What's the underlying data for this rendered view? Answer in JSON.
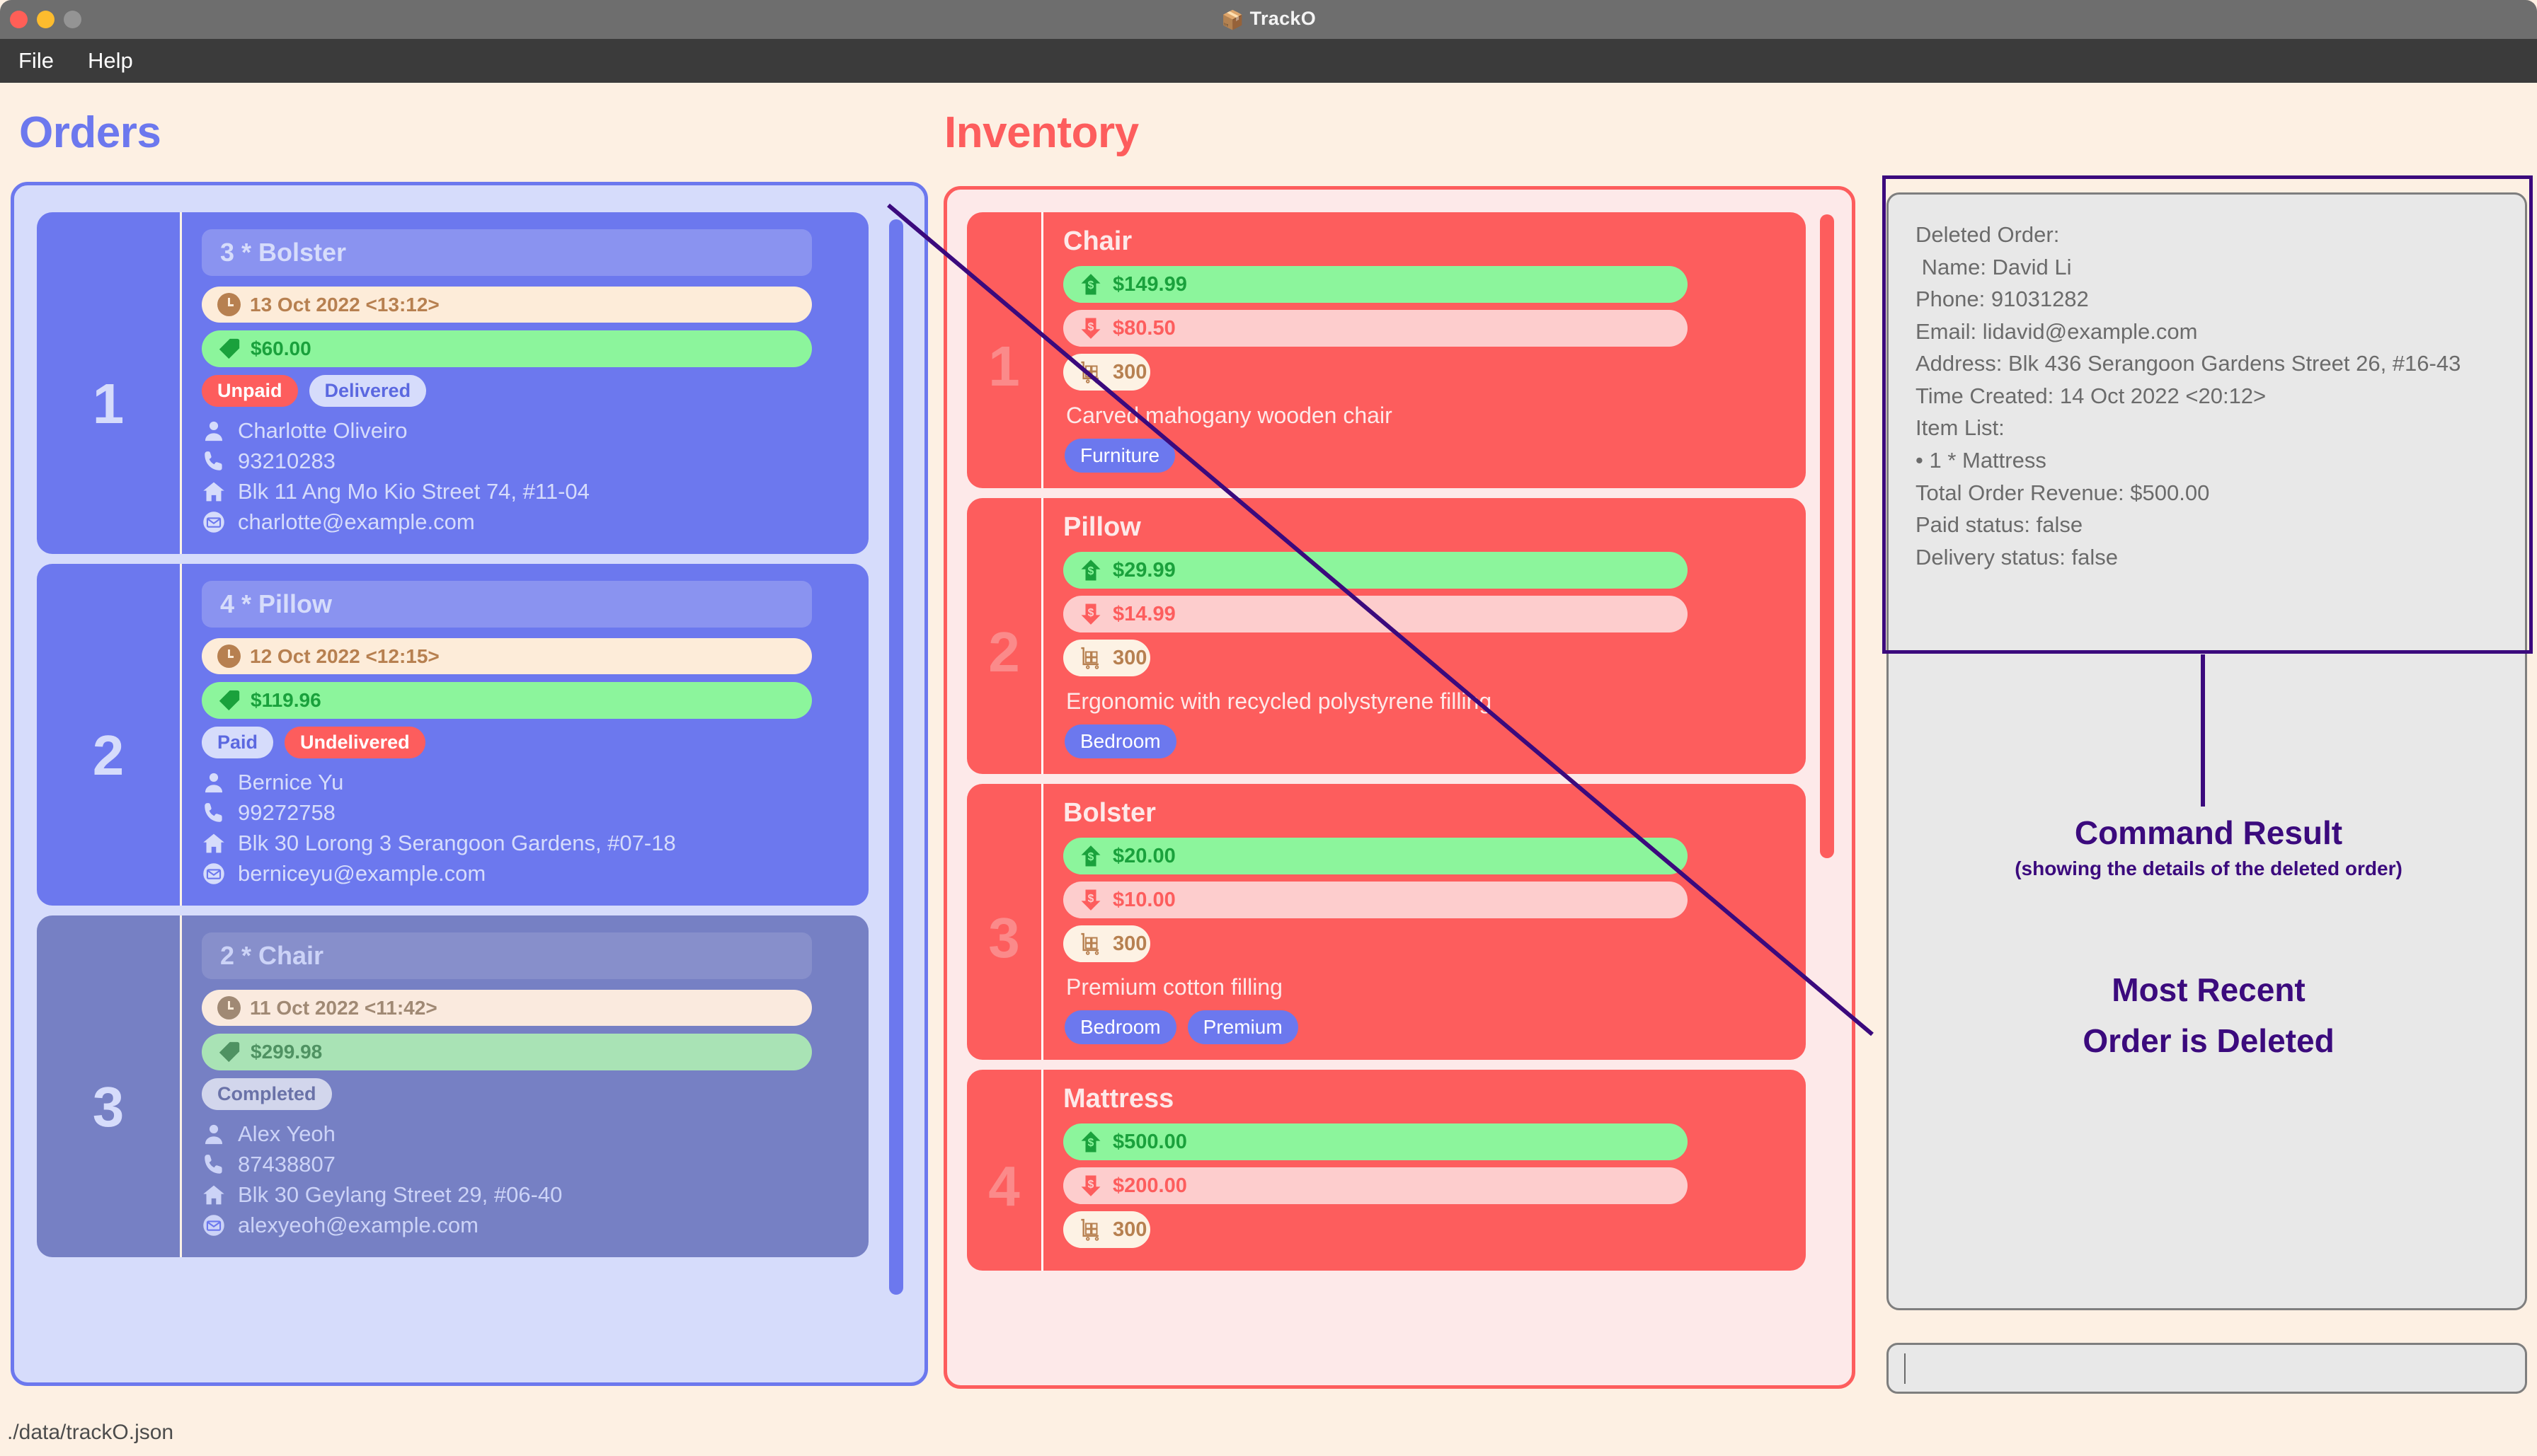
{
  "window": {
    "title": "TrackO",
    "title_icon": "package-box-icon",
    "traffic_lights": [
      "close",
      "minimize",
      "maximize"
    ]
  },
  "menubar": {
    "items": [
      "File",
      "Help"
    ]
  },
  "orders": {
    "heading": "Orders",
    "accent": "#6c78ee",
    "cards": [
      {
        "index": "1",
        "name": "3 * Bolster",
        "time": "13 Oct 2022 <13:12>",
        "price": "$60.00",
        "badges": [
          {
            "label": "Unpaid",
            "style": "unpaid"
          },
          {
            "label": "Delivered",
            "style": "delivered"
          }
        ],
        "customer": "Charlotte Oliveiro",
        "phone": "93210283",
        "address": "Blk 11 Ang Mo Kio Street 74, #11-04",
        "email": "charlotte@example.com",
        "completed": false
      },
      {
        "index": "2",
        "name": "4 * Pillow",
        "time": "12 Oct 2022 <12:15>",
        "price": "$119.96",
        "badges": [
          {
            "label": "Paid",
            "style": "paid"
          },
          {
            "label": "Undelivered",
            "style": "undelivered"
          }
        ],
        "customer": "Bernice Yu",
        "phone": "99272758",
        "address": "Blk 30 Lorong 3 Serangoon Gardens, #07-18",
        "email": "berniceyu@example.com",
        "completed": false
      },
      {
        "index": "3",
        "name": "2 * Chair",
        "time": "11 Oct 2022 <11:42>",
        "price": "$299.98",
        "badges": [
          {
            "label": "Completed",
            "style": "completed"
          }
        ],
        "customer": "Alex Yeoh",
        "phone": "87438807",
        "address": "Blk 30 Geylang Street 29, #06-40",
        "email": "alexyeoh@example.com",
        "completed": true
      }
    ]
  },
  "inventory": {
    "heading": "Inventory",
    "accent": "#fd5d5d",
    "cards": [
      {
        "index": "1",
        "name": "Chair",
        "sale_price": "$149.99",
        "cost_price": "$80.50",
        "stock": "300",
        "description": "Carved mahogany wooden chair",
        "tags": [
          "Furniture"
        ]
      },
      {
        "index": "2",
        "name": "Pillow",
        "sale_price": "$29.99",
        "cost_price": "$14.99",
        "stock": "300",
        "description": "Ergonomic with recycled polystyrene filling",
        "tags": [
          "Bedroom"
        ]
      },
      {
        "index": "3",
        "name": "Bolster",
        "sale_price": "$20.00",
        "cost_price": "$10.00",
        "stock": "300",
        "description": "Premium cotton filling",
        "tags": [
          "Bedroom",
          "Premium"
        ]
      },
      {
        "index": "4",
        "name": "Mattress",
        "sale_price": "$500.00",
        "cost_price": "$200.00",
        "stock": "300",
        "description": "",
        "tags": []
      }
    ]
  },
  "result_panel": {
    "lines": [
      "Deleted Order:",
      " Name: David Li",
      "Phone: 91031282",
      "Email: lidavid@example.com",
      "Address: Blk 436 Serangoon Gardens Street 26, #16-43",
      "Time Created: 14 Oct 2022 <20:12>",
      "Item List:",
      "• 1 * Mattress",
      "Total Order Revenue: $500.00",
      "Paid status: false",
      "Delivery status: false"
    ]
  },
  "command_input": {
    "value": "",
    "placeholder": ""
  },
  "statusbar": {
    "file_path": "./data/trackO.json"
  },
  "annotations": {
    "color": "#3b0a7d",
    "command_result_title": "Command Result",
    "command_result_sub": "(showing the details of the deleted order)",
    "deleted_line1": "Most Recent",
    "deleted_line2": "Order is Deleted"
  }
}
